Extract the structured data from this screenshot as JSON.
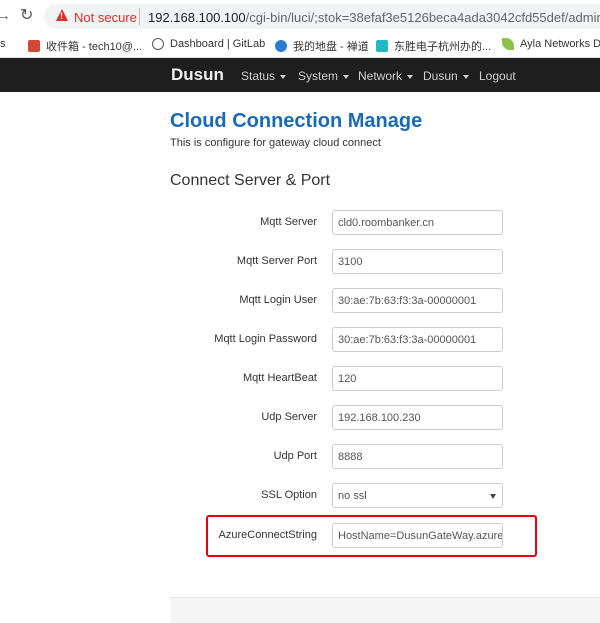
{
  "browser": {
    "security_label": "Not secure",
    "url_host": "192.168.100.100",
    "url_path": "/cgi-bin/luci/;stok=38efaf3e5126beca4ada3042cfd55def/admin/du"
  },
  "bookmarks": [
    {
      "label": "ps",
      "icon": "apps-icon"
    },
    {
      "label": "收件箱 - tech10@...",
      "icon": "mail-icon"
    },
    {
      "label": "Dashboard | GitLab",
      "icon": "gitlab-icon"
    },
    {
      "label": "我的地盘 - 禅道",
      "icon": "globe-icon"
    },
    {
      "label": "东胜电子杭州办的...",
      "icon": "app-icon"
    },
    {
      "label": "Ayla Networks Da",
      "icon": "leaf-icon"
    }
  ],
  "nav": {
    "brand": "Dusun",
    "menu": [
      "Status",
      "System",
      "Network",
      "Dusun",
      "Logout"
    ]
  },
  "page": {
    "title": "Cloud Connection Manage",
    "description": "This is configure for gateway cloud connect",
    "section_title": "Connect Server & Port"
  },
  "form": {
    "mqtt_server": {
      "label": "Mqtt Server",
      "value": "cld0.roombanker.cn"
    },
    "mqtt_server_port": {
      "label": "Mqtt Server Port",
      "value": "3100"
    },
    "mqtt_login_user": {
      "label": "Mqtt Login User",
      "value": "30:ae:7b:63:f3:3a-00000001"
    },
    "mqtt_login_password": {
      "label": "Mqtt Login Password",
      "value": "30:ae:7b:63:f3:3a-00000001"
    },
    "mqtt_heartbeat": {
      "label": "Mqtt HeartBeat",
      "value": "120"
    },
    "udp_server": {
      "label": "Udp Server",
      "value": "192.168.100.230"
    },
    "udp_port": {
      "label": "Udp Port",
      "value": "8888"
    },
    "ssl_option": {
      "label": "SSL Option",
      "value": "no ssl"
    },
    "azure_connect_string": {
      "label": "AzureConnectString",
      "value": "HostName=DusunGateWay.azure-"
    }
  },
  "colors": {
    "title_blue": "#1a6ab8",
    "navbar_bg": "#1e1e1e",
    "highlight_red": "#e60012",
    "warning_red": "#d93025"
  }
}
